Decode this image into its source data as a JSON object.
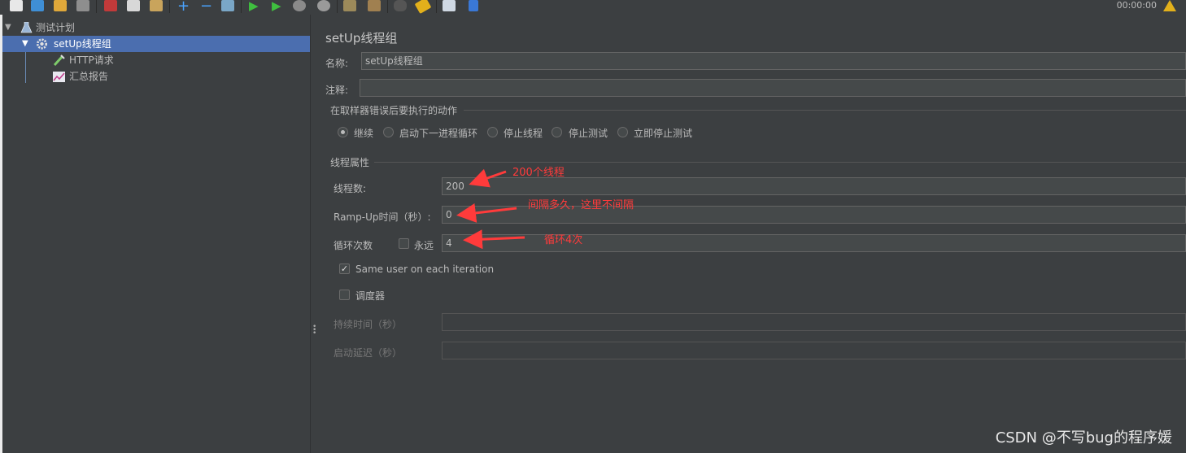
{
  "toolbar": {
    "timer": "00:00:00",
    "icons": [
      "new-icon",
      "templates-icon",
      "open-icon",
      "save-icon",
      "cut-icon",
      "copy-icon",
      "paste-icon",
      "expand-icon",
      "collapse-icon",
      "toggle-icon",
      "start-icon",
      "start-no-pause-icon",
      "stop-icon",
      "shutdown-icon",
      "clear-icon",
      "clear-all-icon",
      "search-icon",
      "reset-search-icon",
      "function-helper-icon",
      "help-icon"
    ]
  },
  "tree": {
    "root": "测试计划",
    "thread_group": "setUp线程组",
    "sampler": "HTTP请求",
    "listener": "汇总报告"
  },
  "panel": {
    "title": "setUp线程组",
    "name_label": "名称:",
    "name_value": "setUp线程组",
    "comment_label": "注释:",
    "comment_value": "",
    "error_group_title": "在取样器错误后要执行的动作",
    "error_options": [
      "继续",
      "启动下一进程循环",
      "停止线程",
      "停止测试",
      "立即停止测试"
    ],
    "error_selected": "继续",
    "thread_props_title": "线程属性",
    "threads_label": "线程数:",
    "threads_value": "200",
    "rampup_label": "Ramp-Up时间（秒）:",
    "rampup_value": "0",
    "loop_label": "循环次数",
    "forever_label": "永远",
    "forever_checked": false,
    "loop_value": "4",
    "same_user_label": "Same user on each iteration",
    "same_user_checked": true,
    "scheduler_label": "调度器",
    "scheduler_checked": false,
    "duration_label": "持续时间（秒）",
    "duration_value": "",
    "delay_label": "启动延迟（秒）",
    "delay_value": ""
  },
  "annotations": {
    "threads_note": "200个线程",
    "rampup_note": "间隔多久，这里不间隔",
    "loop_note": "循环4次",
    "color": "#ff3b3b"
  },
  "watermark": "CSDN @不写bug的程序媛"
}
